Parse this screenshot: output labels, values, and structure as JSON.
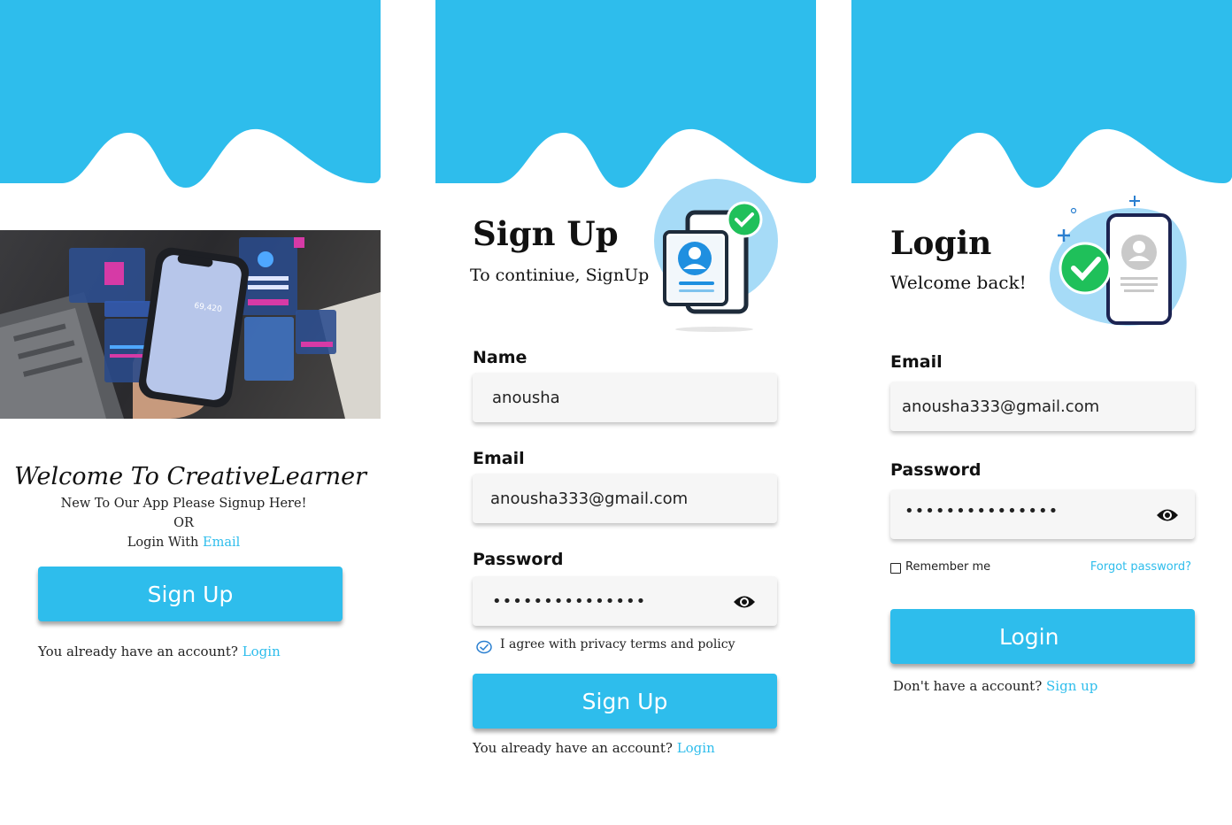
{
  "colors": {
    "accent": "#2ebdec",
    "wave": "#2ebdec",
    "field_bg": "#f6f6f6"
  },
  "welcome": {
    "title": "Welcome To CreativeLearner",
    "line1": "New To Our App Please Signup Here!",
    "or": "OR",
    "login_with": "Login With",
    "email_link": "Email",
    "signup_button": "Sign Up",
    "have_account": "You already have an account?",
    "login_link": "Login",
    "hero_image": "phone-app-hero-photo"
  },
  "signup": {
    "title": "Sign Up",
    "subtitle": "To continiue, SignUp",
    "illustration": "profile-card-phone-illustration",
    "name_label": "Name",
    "name_value": "anousha",
    "email_label": "Email",
    "email_value": "anousha333@gmail.com",
    "password_label": "Password",
    "password_value": "•••••••••••••••",
    "eye_icon": "eye-icon",
    "agree_text": "I agree with privacy terms and policy",
    "signup_button": "Sign Up",
    "have_account": "You already have an account?",
    "login_link": "Login"
  },
  "login": {
    "title": "Login",
    "subtitle": "Welcome back!",
    "illustration": "verified-phone-illustration",
    "email_label": "Email",
    "email_value": "anousha333@gmail.com",
    "password_label": "Password",
    "password_value": "•••••••••••••••",
    "remember": "Remember me",
    "forgot": "Forgot password?",
    "login_button": "Login",
    "no_account": "Don't have a account?",
    "signup_link": "Sign up"
  }
}
